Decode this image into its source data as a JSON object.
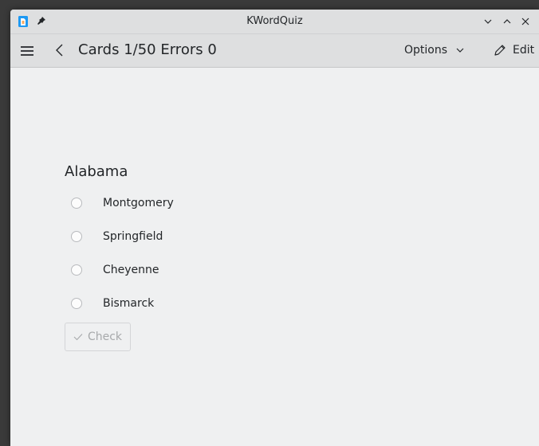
{
  "window": {
    "title": "KWordQuiz"
  },
  "toolbar": {
    "title": "Cards 1/50 Errors 0",
    "options_label": "Options",
    "edit_label": "Edit"
  },
  "quiz": {
    "question": "Alabama",
    "options": [
      {
        "label": "Montgomery",
        "checked": false
      },
      {
        "label": "Springfield",
        "checked": false
      },
      {
        "label": "Cheyenne",
        "checked": false
      },
      {
        "label": "Bismarck",
        "checked": false
      }
    ],
    "check_label": "Check",
    "check_enabled": false
  },
  "colors": {
    "window_bg": "#eff0f1",
    "header_bg": "#dedfe0",
    "text": "#232629",
    "disabled_text": "#a7a9ab"
  }
}
